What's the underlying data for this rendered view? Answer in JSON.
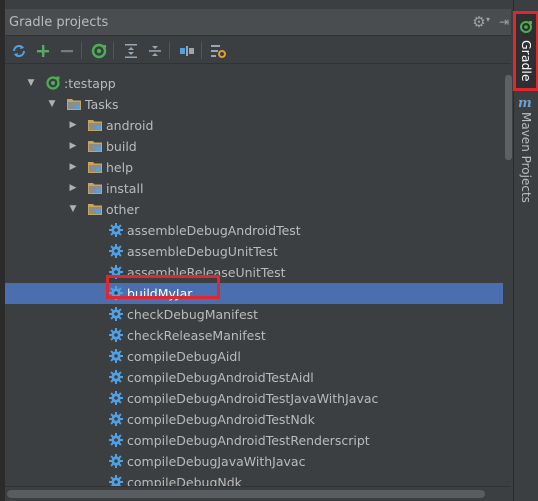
{
  "panel": {
    "title": "Gradle projects"
  },
  "toolbar": {
    "buttons": [
      {
        "name": "refresh-all-icon"
      },
      {
        "name": "add-icon"
      },
      {
        "name": "remove-icon"
      },
      {
        "name": "execute-task-icon"
      },
      {
        "name": "expand-all-icon"
      },
      {
        "name": "collapse-all-icon"
      },
      {
        "name": "toggle-offline-icon"
      },
      {
        "name": "settings-icon"
      }
    ]
  },
  "tree": {
    "project": ":testapp",
    "tasks_folder": "Tasks",
    "groups": [
      "android",
      "build",
      "help",
      "install",
      "other"
    ],
    "other_tasks": [
      "assembleDebugAndroidTest",
      "assembleDebugUnitTest",
      "assembleReleaseUnitTest",
      "buildMyJar",
      "checkDebugManifest",
      "checkReleaseManifest",
      "compileDebugAidl",
      "compileDebugAndroidTestAidl",
      "compileDebugAndroidTestJavaWithJavac",
      "compileDebugAndroidTestNdk",
      "compileDebugAndroidTestRenderscript",
      "compileDebugJavaWithJavac",
      "compileDebugNdk"
    ],
    "selected_task": "buildMyJar"
  },
  "sidebar": {
    "gradle_label": "Gradle",
    "maven_label": "Maven Projects",
    "maven_icon": "m"
  },
  "colors": {
    "selection": "#4b6eaf",
    "highlight": "#e0272d",
    "gradle_green": "#4caf50",
    "gear_blue": "#4fa1e6",
    "folder": "#c9a55a"
  }
}
